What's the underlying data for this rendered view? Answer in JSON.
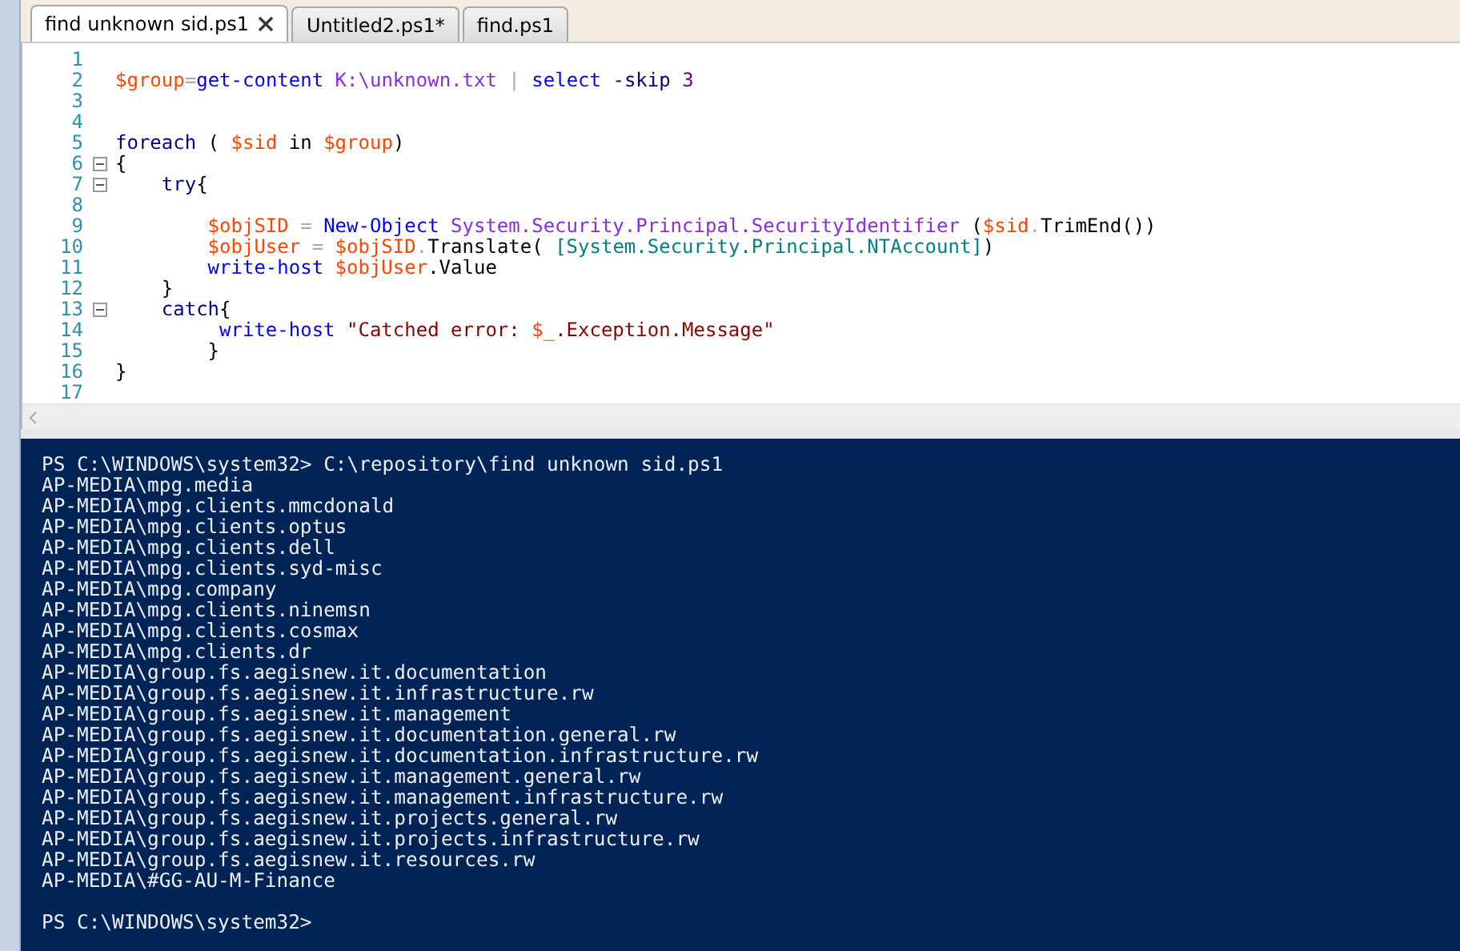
{
  "tabs": [
    {
      "label": "find unknown sid.ps1",
      "selected": true
    },
    {
      "label": "Untitled2.ps1*",
      "selected": false
    },
    {
      "label": "find.ps1",
      "selected": false
    }
  ],
  "editor": {
    "lines": [
      {
        "number": "1",
        "fold": false
      },
      {
        "number": "2",
        "fold": false,
        "tokens": [
          {
            "kind": "variable",
            "text": "$group"
          },
          {
            "kind": "operator",
            "text": "="
          },
          {
            "kind": "command",
            "text": "get-content"
          },
          {
            "kind": "argument",
            "text": " K:\\unknown.txt"
          },
          {
            "kind": "operator",
            "text": " | "
          },
          {
            "kind": "command",
            "text": "select"
          },
          {
            "kind": "parameter",
            "text": " -skip"
          },
          {
            "kind": "number",
            "text": " 3"
          }
        ]
      },
      {
        "number": "3",
        "fold": false
      },
      {
        "number": "4",
        "fold": false
      },
      {
        "number": "5",
        "fold": false,
        "tokens": [
          {
            "kind": "keyword",
            "text": "foreach"
          },
          {
            "kind": "plain",
            "text": " ( "
          },
          {
            "kind": "variable",
            "text": "$sid"
          },
          {
            "kind": "plain",
            "text": " in "
          },
          {
            "kind": "variable",
            "text": "$group"
          },
          {
            "kind": "plain",
            "text": ")"
          }
        ]
      },
      {
        "number": "6",
        "fold": true,
        "tokens": [
          {
            "kind": "plain",
            "text": "{"
          }
        ]
      },
      {
        "number": "7",
        "fold": true,
        "tokens": [
          {
            "kind": "keyword",
            "text": "    try"
          },
          {
            "kind": "plain",
            "text": "{"
          }
        ]
      },
      {
        "number": "8",
        "fold": false
      },
      {
        "number": "9",
        "fold": false,
        "tokens": [
          {
            "kind": "variable",
            "text": "        $objSID"
          },
          {
            "kind": "operator",
            "text": " = "
          },
          {
            "kind": "command",
            "text": "New-Object"
          },
          {
            "kind": "argument",
            "text": " System.Security.Principal.SecurityIdentifier"
          },
          {
            "kind": "plain",
            "text": " ("
          },
          {
            "kind": "variable",
            "text": "$sid"
          },
          {
            "kind": "operator",
            "text": "."
          },
          {
            "kind": "member",
            "text": "TrimEnd"
          },
          {
            "kind": "plain",
            "text": "())"
          }
        ]
      },
      {
        "number": "10",
        "fold": false,
        "tokens": [
          {
            "kind": "variable",
            "text": "        $objUser"
          },
          {
            "kind": "operator",
            "text": " = "
          },
          {
            "kind": "variable",
            "text": "$objSID"
          },
          {
            "kind": "operator",
            "text": "."
          },
          {
            "kind": "member",
            "text": "Translate"
          },
          {
            "kind": "plain",
            "text": "( "
          },
          {
            "kind": "type",
            "text": "[System.Security.Principal.NTAccount]"
          },
          {
            "kind": "plain",
            "text": ")"
          }
        ]
      },
      {
        "number": "11",
        "fold": false,
        "tokens": [
          {
            "kind": "command",
            "text": "        write-host"
          },
          {
            "kind": "variable",
            "text": " $objUser"
          },
          {
            "kind": "member",
            "text": ".Value"
          }
        ]
      },
      {
        "number": "12",
        "fold": false,
        "tokens": [
          {
            "kind": "plain",
            "text": "    }"
          }
        ]
      },
      {
        "number": "13",
        "fold": true,
        "tokens": [
          {
            "kind": "keyword",
            "text": "    catch"
          },
          {
            "kind": "plain",
            "text": "{"
          }
        ]
      },
      {
        "number": "14",
        "fold": false,
        "tokens": [
          {
            "kind": "command",
            "text": "         write-host"
          },
          {
            "kind": "string",
            "text": " \"Catched error: "
          },
          {
            "kind": "variable",
            "text": "$_"
          },
          {
            "kind": "string",
            "text": ".Exception.Message\""
          }
        ]
      },
      {
        "number": "15",
        "fold": false,
        "tokens": [
          {
            "kind": "plain",
            "text": "        }"
          }
        ]
      },
      {
        "number": "16",
        "fold": false,
        "tokens": [
          {
            "kind": "plain",
            "text": "}"
          }
        ]
      },
      {
        "number": "17",
        "fold": false
      }
    ]
  },
  "console": {
    "command_line": "PS C:\\WINDOWS\\system32> C:\\repository\\find unknown sid.ps1",
    "output_lines": [
      "AP-MEDIA\\mpg.media",
      "AP-MEDIA\\mpg.clients.mmcdonald",
      "AP-MEDIA\\mpg.clients.optus",
      "AP-MEDIA\\mpg.clients.dell",
      "AP-MEDIA\\mpg.clients.syd-misc",
      "AP-MEDIA\\mpg.company",
      "AP-MEDIA\\mpg.clients.ninemsn",
      "AP-MEDIA\\mpg.clients.cosmax",
      "AP-MEDIA\\mpg.clients.dr",
      "AP-MEDIA\\group.fs.aegisnew.it.documentation",
      "AP-MEDIA\\group.fs.aegisnew.it.infrastructure.rw",
      "AP-MEDIA\\group.fs.aegisnew.it.management",
      "AP-MEDIA\\group.fs.aegisnew.it.documentation.general.rw",
      "AP-MEDIA\\group.fs.aegisnew.it.documentation.infrastructure.rw",
      "AP-MEDIA\\group.fs.aegisnew.it.management.general.rw",
      "AP-MEDIA\\group.fs.aegisnew.it.management.infrastructure.rw",
      "AP-MEDIA\\group.fs.aegisnew.it.projects.general.rw",
      "AP-MEDIA\\group.fs.aegisnew.it.projects.infrastructure.rw",
      "AP-MEDIA\\group.fs.aegisnew.it.resources.rw",
      "AP-MEDIA\\#GG-AU-M-Finance"
    ],
    "prompt": "PS C:\\WINDOWS\\system32>"
  }
}
